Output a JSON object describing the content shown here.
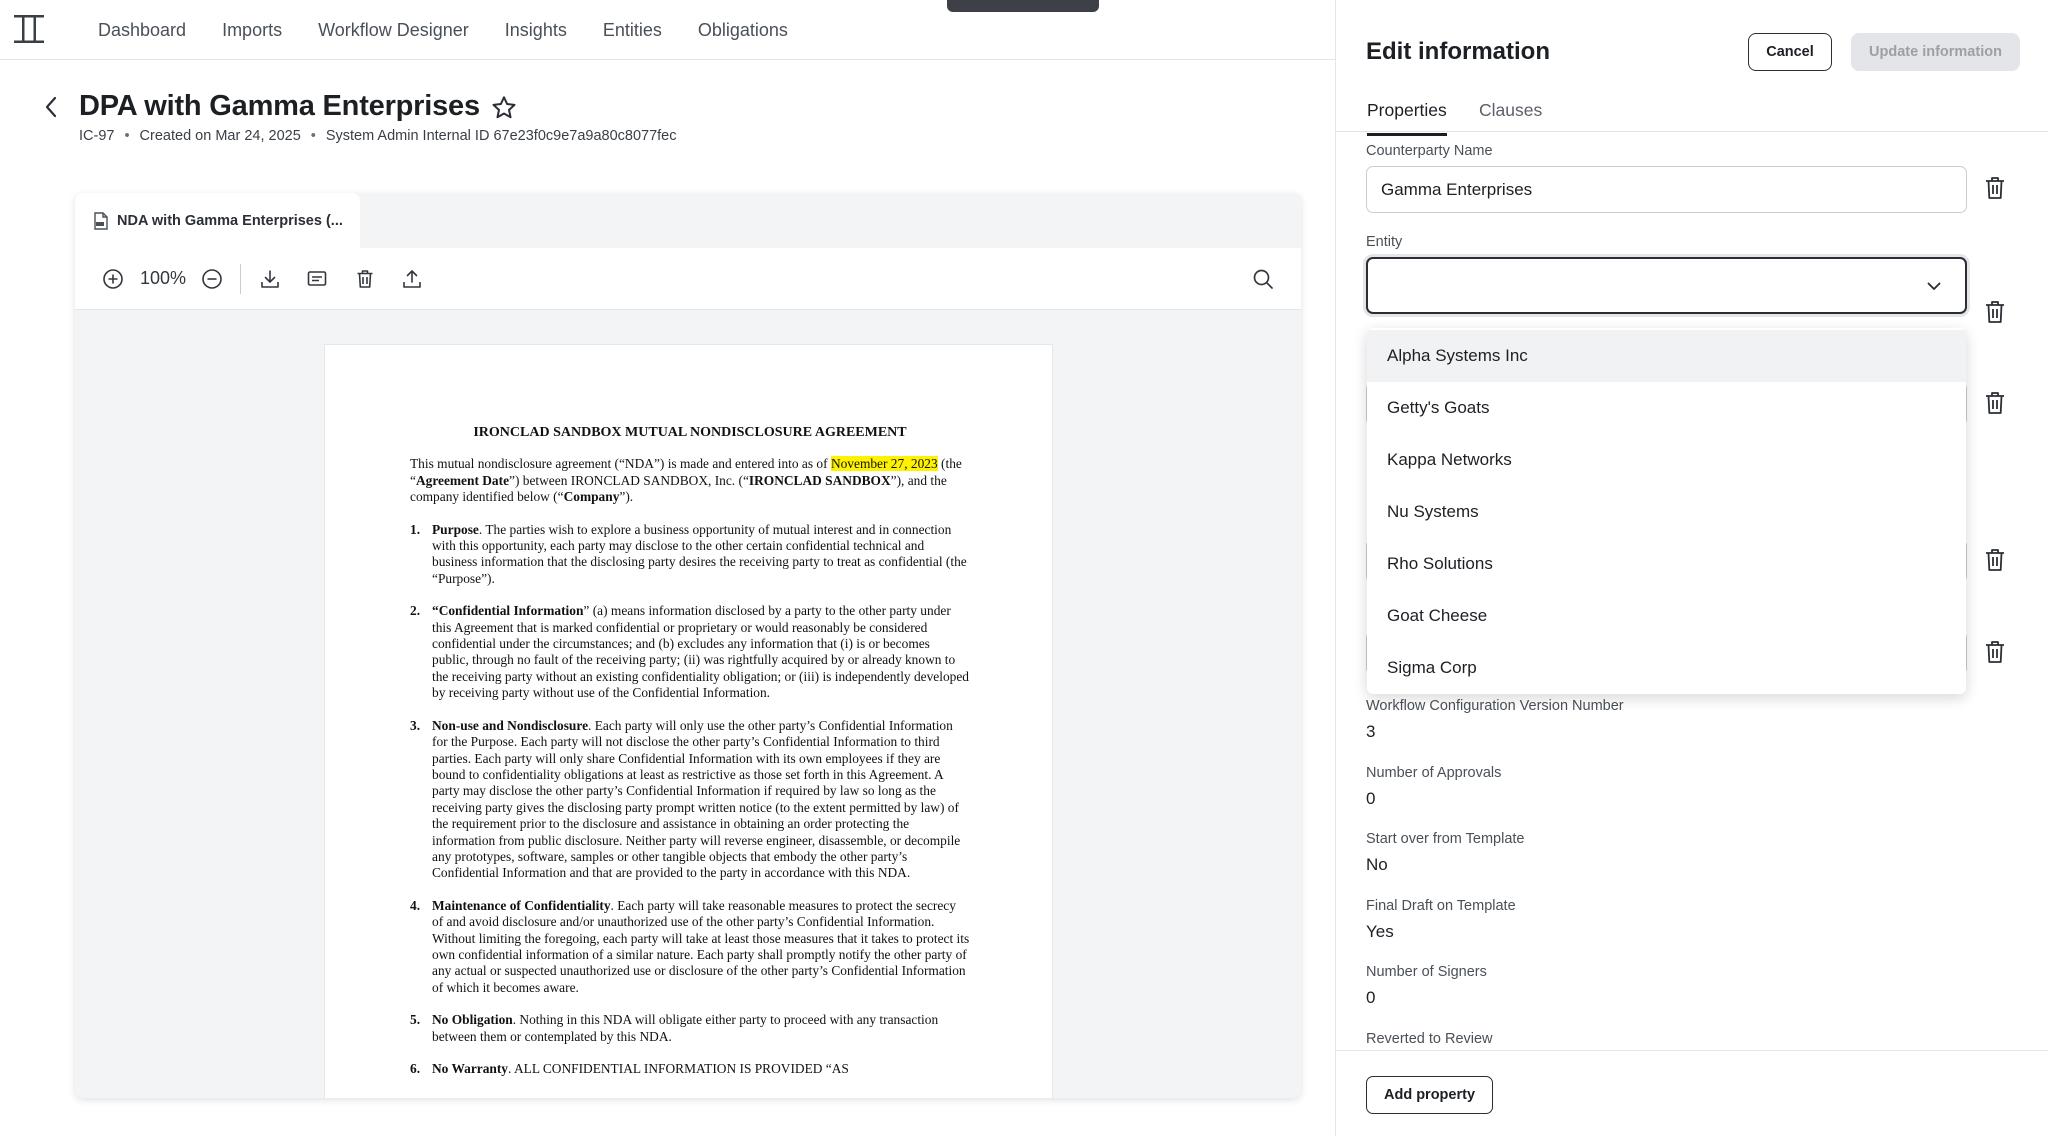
{
  "nav": {
    "items": [
      "Dashboard",
      "Imports",
      "Workflow Designer",
      "Insights",
      "Entities",
      "Obligations"
    ]
  },
  "header": {
    "title": "DPA with Gamma Enterprises",
    "meta": {
      "record_id": "IC-97",
      "created": "Created on Mar 24, 2025",
      "internal_id": "System Admin Internal ID 67e23f0c9e7a9a80c8077fec"
    }
  },
  "viewer": {
    "file_tab": "NDA with Gamma Enterprises (...",
    "zoom": "100%"
  },
  "document": {
    "title": "IRONCLAD SANDBOX MUTUAL NONDISCLOSURE AGREEMENT",
    "intro": {
      "a": "This mutual nondisclosure agreement (“NDA”) is made and entered into as of ",
      "date": "November 27, 2023",
      "b": " (the “",
      "agreement_date": "Agreement Date",
      "c": "”) between IRONCLAD SANDBOX, Inc. (“",
      "ironclad": "IRONCLAD SANDBOX",
      "d": "”), and the company identified below (“",
      "company": "Company",
      "e": "”)."
    },
    "sections": [
      {
        "num": "1.",
        "head": "Purpose",
        "text": ".  The parties wish to explore a business opportunity of mutual interest and in connection with this opportunity, each party may disclose to the other certain confidential technical and business information that the disclosing party desires the receiving party to treat as confidential (the “Purpose”)."
      },
      {
        "num": "2.",
        "head": "“Confidential Information",
        "text": "” (a) means information disclosed by a party to the other party under this Agreement that is marked confidential or proprietary or would reasonably be considered confidential under the circumstances; and (b) excludes any information that (i) is or becomes public, through no fault of the receiving party; (ii) was rightfully acquired by or already known to the receiving party without an existing confidentiality obligation; or (iii) is independently developed by receiving party without use of the Confidential Information."
      },
      {
        "num": "3.",
        "head": "Non-use and Nondisclosure",
        "text": ".  Each party will only use the other party’s Confidential Information for the Purpose.  Each party will not disclose the other party’s Confidential Information to third parties.  Each party will only share Confidential Information with its own employees if they are bound to confidentiality obligations at least as restrictive as those set forth in this Agreement.  A party may disclose the other party’s Confidential Information if required by law so long as the receiving party gives the disclosing party prompt written notice (to the extent permitted by law) of the requirement prior to the disclosure and assistance in obtaining an order protecting the information from public disclosure.  Neither party will reverse engineer, disassemble, or decompile any prototypes, software, samples or other tangible objects that embody the other party’s Confidential Information and that are provided to the party in accordance with this NDA."
      },
      {
        "num": "4.",
        "head": "Maintenance of Confidentiality",
        "text": ".  Each party will take reasonable measures to protect the secrecy of and avoid disclosure and/or unauthorized use of the other party’s Confidential Information.  Without limiting the foregoing, each party will take at least those measures that it takes to protect its own confidential information of a similar nature.  Each party shall promptly notify the other party of any actual or suspected unauthorized use or disclosure of the other party’s Confidential Information of which it becomes aware."
      },
      {
        "num": "5.",
        "head": "No Obligation",
        "text": ".  Nothing in this NDA will obligate either party to proceed with any transaction between them or contemplated by this NDA."
      },
      {
        "num": "6.",
        "head": "No Warranty",
        "text": ".  ALL CONFIDENTIAL INFORMATION IS PROVIDED “AS"
      }
    ]
  },
  "panel": {
    "title": "Edit information",
    "cancel": "Cancel",
    "update": "Update information",
    "tabs": [
      "Properties",
      "Clauses"
    ],
    "counterparty_label": "Counterparty Name",
    "counterparty_value": "Gamma Enterprises",
    "entity_label": "Entity",
    "entity_value": "",
    "entity_options": [
      "Alpha Systems Inc",
      "Getty's Goats",
      "Kappa Networks",
      "Nu Systems",
      "Rho Solutions",
      "Goat Cheese",
      "Sigma Corp"
    ],
    "props": [
      {
        "label": "Workflow Configuration Version Number",
        "value": "3"
      },
      {
        "label": "Number of Approvals",
        "value": "0"
      },
      {
        "label": "Start over from Template",
        "value": "No"
      },
      {
        "label": "Final Draft on Template",
        "value": "Yes"
      },
      {
        "label": "Number of Signers",
        "value": "0"
      },
      {
        "label": "Reverted to Review",
        "value": ""
      }
    ],
    "add_property": "Add property"
  }
}
